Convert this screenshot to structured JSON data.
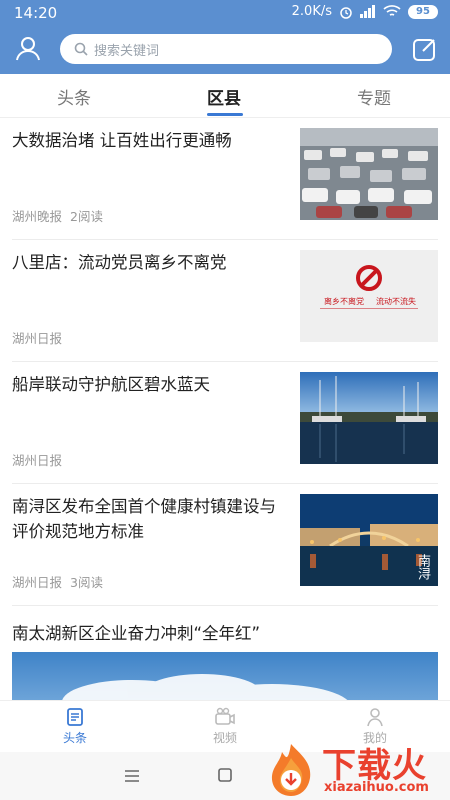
{
  "status_bar": {
    "time": "14:20",
    "network_speed": "2.0K/s",
    "battery": "95"
  },
  "header": {
    "search_placeholder": "搜索关键词"
  },
  "tabs": [
    {
      "label": "头条",
      "active": false
    },
    {
      "label": "区县",
      "active": true
    },
    {
      "label": "专题",
      "active": false
    }
  ],
  "feed": [
    {
      "title": "大数据治堵 让百姓出行更通畅",
      "source": "湖州晚报",
      "reads": "2阅读",
      "image": "traffic-jam"
    },
    {
      "title": "八里店：流动党员离乡不离党",
      "source": "湖州日报",
      "reads": "",
      "image": "party-banner",
      "image_caption_left": "离乡不离党",
      "image_caption_right": "流动不流失"
    },
    {
      "title": "船岸联动守护航区碧水蓝天",
      "source": "湖州日报",
      "reads": "",
      "image": "harbor"
    },
    {
      "title": "南浔区发布全国首个健康村镇建设与评价规范地方标准",
      "source": "湖州日报",
      "reads": "3阅读",
      "image": "water-town-night",
      "image_caption": "南浔"
    }
  ],
  "featured": {
    "title": "南太湖新区企业奋力冲刺“全年红”"
  },
  "bottom_nav": [
    {
      "label": "头条",
      "active": true
    },
    {
      "label": "视频",
      "active": false
    },
    {
      "label": "我的",
      "active": false
    }
  ],
  "watermark": {
    "cn": "下载火",
    "en": "xiazaihuo.com"
  },
  "colors": {
    "header_bg": "#5b8fd0",
    "accent": "#3a79d4",
    "watermark": "#e9412e"
  }
}
